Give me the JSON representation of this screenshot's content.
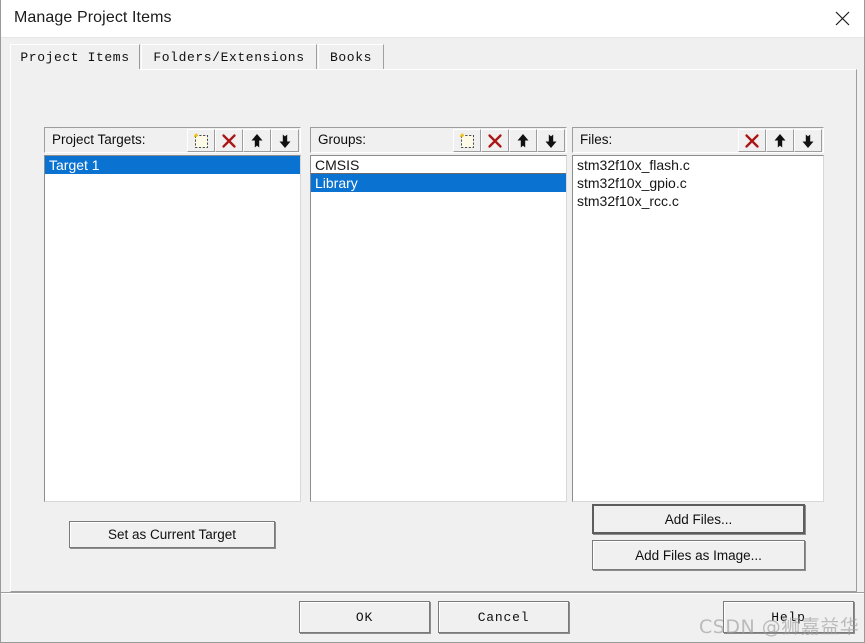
{
  "window": {
    "title": "Manage Project Items",
    "close_icon": "close-icon"
  },
  "tabs": [
    {
      "label": "Project Items",
      "active": true
    },
    {
      "label": "Folders/Extensions",
      "active": false
    },
    {
      "label": "Books",
      "active": false
    }
  ],
  "panels": {
    "targets": {
      "label": "Project Targets:",
      "icons": [
        "new-item-icon",
        "delete-icon",
        "move-up-icon",
        "move-down-icon"
      ],
      "items": [
        {
          "label": "Target 1",
          "selected": true
        }
      ]
    },
    "groups": {
      "label": "Groups:",
      "icons": [
        "new-item-icon",
        "delete-icon",
        "move-up-icon",
        "move-down-icon"
      ],
      "items": [
        {
          "label": "CMSIS",
          "selected": false,
          "focused": true
        },
        {
          "label": "Library",
          "selected": true
        }
      ]
    },
    "files": {
      "label": "Files:",
      "icons": [
        "delete-icon",
        "move-up-icon",
        "move-down-icon"
      ],
      "items": [
        {
          "label": "stm32f10x_flash.c",
          "selected": false
        },
        {
          "label": "stm32f10x_gpio.c",
          "selected": false
        },
        {
          "label": "stm32f10x_rcc.c",
          "selected": false
        }
      ]
    }
  },
  "buttons": {
    "set_as_current_target": "Set as Current Target",
    "add_files": "Add Files...",
    "add_files_as_image": "Add Files as Image...",
    "ok": "OK",
    "cancel": "Cancel",
    "help": "Help"
  },
  "watermark": {
    "text": "CSDN @狮嘉益华"
  },
  "colors": {
    "selection_blue": "#0a72d0",
    "delete_red": "#a91616",
    "dialog_face": "#f0f0f0",
    "titlebar": "#ffffff"
  }
}
